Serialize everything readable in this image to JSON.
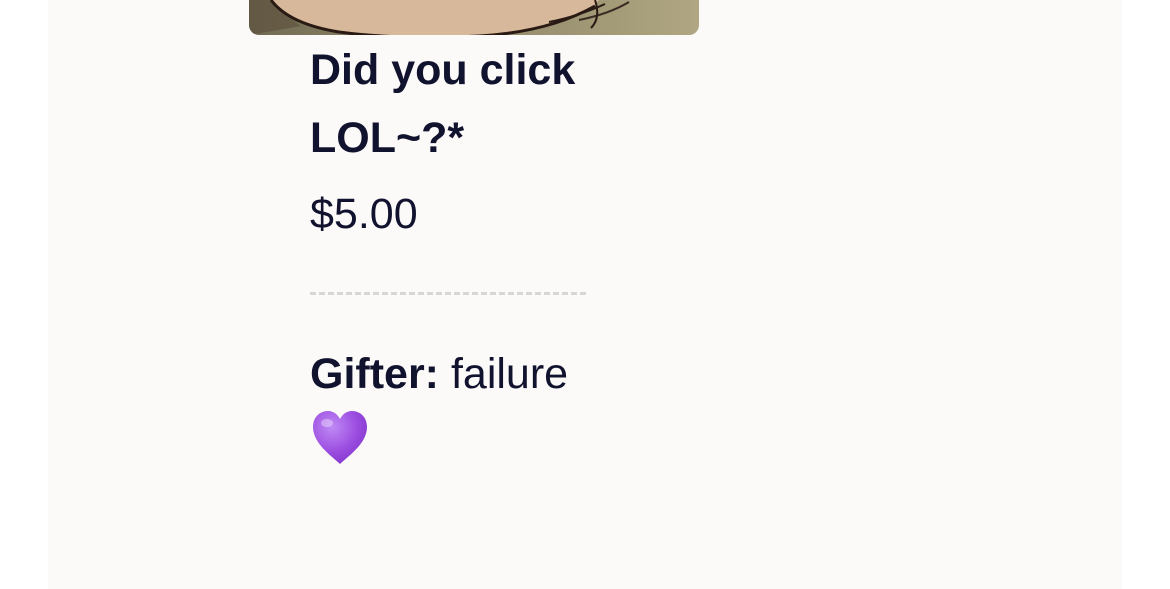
{
  "item": {
    "title": "Did you click LOL~?*",
    "price": "$5.00",
    "gifter_label": "Gifter:",
    "gifter_name": "failure",
    "heart_icon": "purple-heart-icon",
    "heart_color": "#9b4de0"
  },
  "colors": {
    "text": "#11132e",
    "page_background": "#fcf9f9",
    "divider": "#d6d6d6"
  }
}
